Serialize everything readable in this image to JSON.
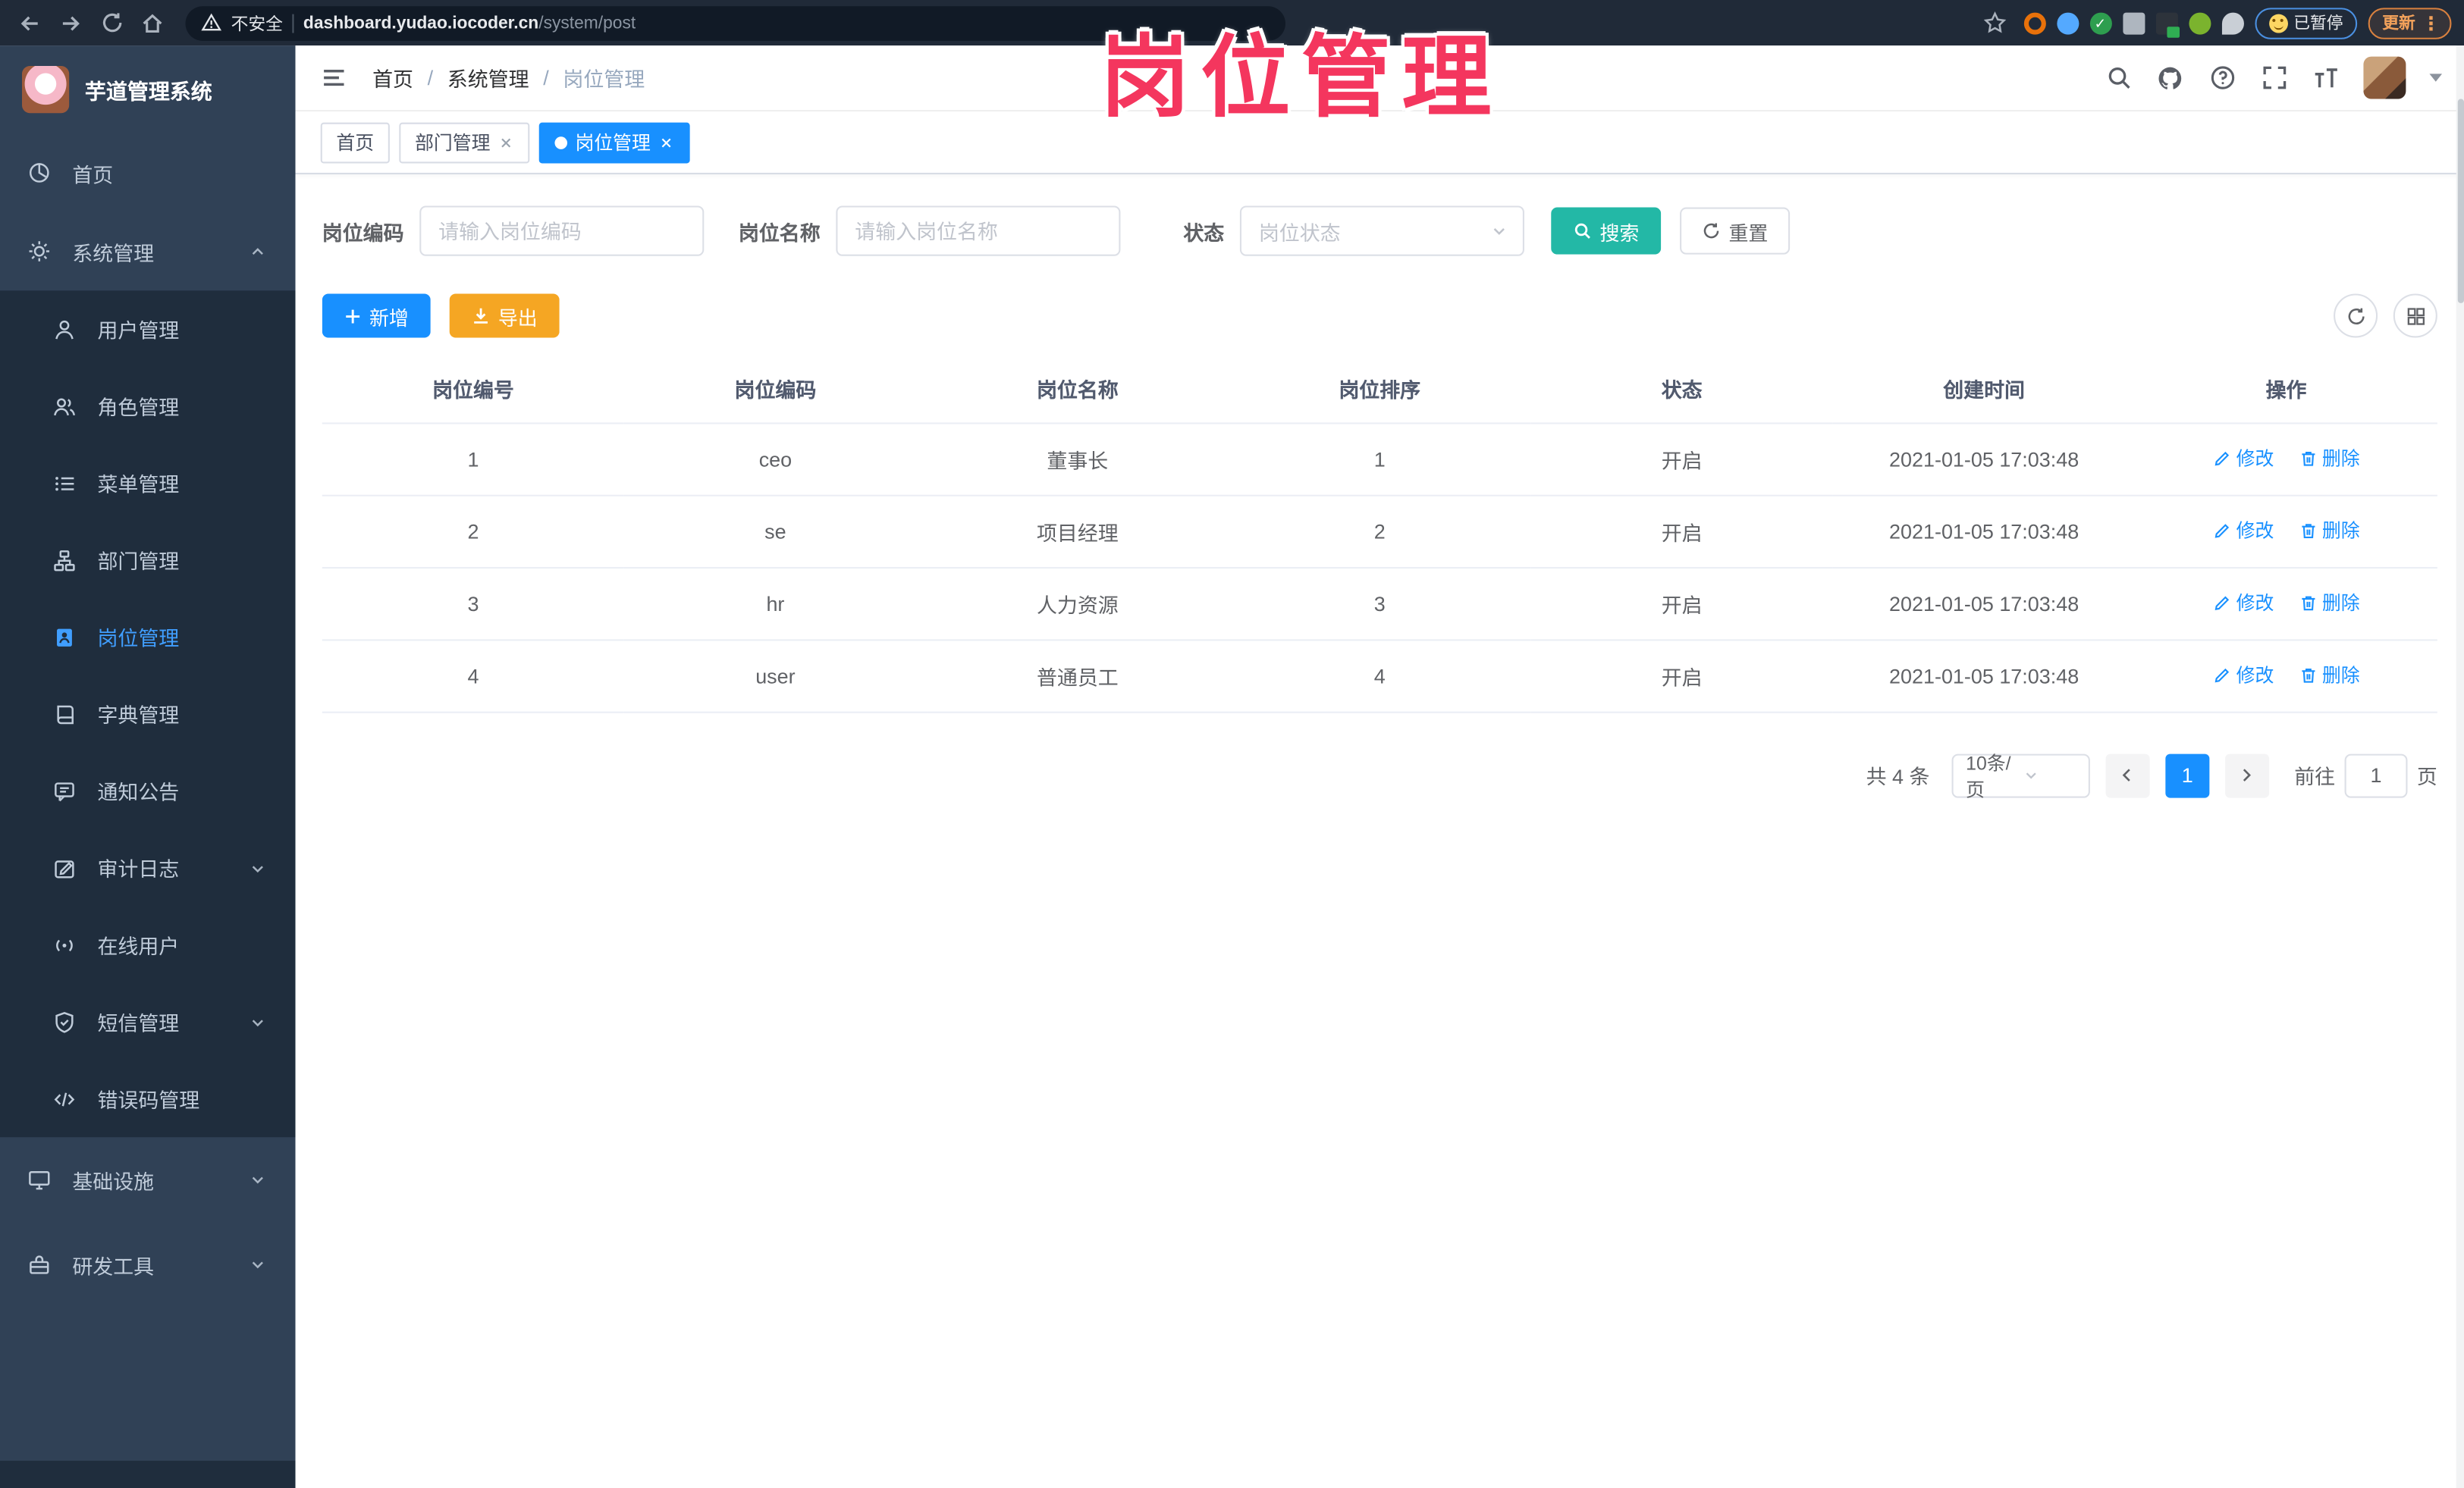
{
  "colors": {
    "primary": "#1890ff",
    "sidebar_bg": "#304156",
    "sidebar_sub_bg": "#1f2d3d",
    "sidebar_active": "#409eff",
    "search_button": "#23b8a6",
    "export_button": "#f5a623",
    "watermark": "#f4365e"
  },
  "overlay_title": "岗位管理",
  "browser": {
    "security": "不安全",
    "url_host": "dashboard.yudao.iocoder.cn",
    "url_path": "/system/post",
    "paused_badge": "已暂停",
    "update_button": "更新"
  },
  "sidebar": {
    "title": "芋道管理系统",
    "items": [
      {
        "label": "首页"
      },
      {
        "label": "系统管理"
      },
      {
        "label": "用户管理"
      },
      {
        "label": "角色管理"
      },
      {
        "label": "菜单管理"
      },
      {
        "label": "部门管理"
      },
      {
        "label": "岗位管理"
      },
      {
        "label": "字典管理"
      },
      {
        "label": "通知公告"
      },
      {
        "label": "审计日志"
      },
      {
        "label": "在线用户"
      },
      {
        "label": "短信管理"
      },
      {
        "label": "错误码管理"
      },
      {
        "label": "基础设施"
      },
      {
        "label": "研发工具"
      }
    ]
  },
  "navbar": {
    "breadcrumb": [
      "首页",
      "系统管理",
      "岗位管理"
    ]
  },
  "tabs": [
    {
      "label": "首页"
    },
    {
      "label": "部门管理"
    },
    {
      "label": "岗位管理"
    }
  ],
  "filters": {
    "code_label": "岗位编码",
    "code_placeholder": "请输入岗位编码",
    "name_label": "岗位名称",
    "name_placeholder": "请输入岗位名称",
    "status_label": "状态",
    "status_placeholder": "岗位状态",
    "search": "搜索",
    "reset": "重置"
  },
  "toolbar": {
    "add": "新增",
    "export": "导出"
  },
  "table": {
    "headers": [
      "岗位编号",
      "岗位编码",
      "岗位名称",
      "岗位排序",
      "状态",
      "创建时间",
      "操作"
    ],
    "edit": "修改",
    "delete": "删除",
    "rows": [
      {
        "id": "1",
        "code": "ceo",
        "name": "董事长",
        "sort": "1",
        "status": "开启",
        "time": "2021-01-05 17:03:48"
      },
      {
        "id": "2",
        "code": "se",
        "name": "项目经理",
        "sort": "2",
        "status": "开启",
        "time": "2021-01-05 17:03:48"
      },
      {
        "id": "3",
        "code": "hr",
        "name": "人力资源",
        "sort": "3",
        "status": "开启",
        "time": "2021-01-05 17:03:48"
      },
      {
        "id": "4",
        "code": "user",
        "name": "普通员工",
        "sort": "4",
        "status": "开启",
        "time": "2021-01-05 17:03:48"
      }
    ]
  },
  "pagination": {
    "total": "共 4 条",
    "size": "10条/页",
    "page": "1",
    "goto_prefix": "前往",
    "goto_suffix": "页",
    "goto_value": "1"
  }
}
